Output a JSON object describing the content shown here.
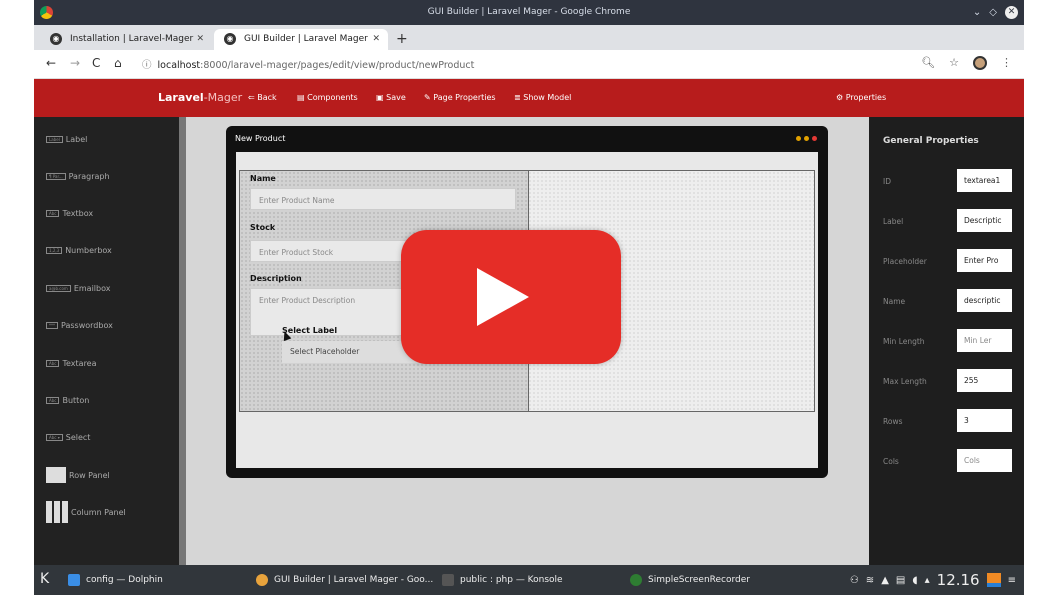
{
  "window_title": "GUI Builder | Laravel Mager - Google Chrome",
  "tabs": [
    {
      "label": "Installation | Laravel-Mager"
    },
    {
      "label": "GUI Builder | Laravel Mager"
    }
  ],
  "address": {
    "host": "localhost",
    "path": ":8000/laravel-mager/pages/edit/view/product/newProduct"
  },
  "app": {
    "brand_bold": "Laravel",
    "brand_rest": "-Mager",
    "nav": {
      "back": "Back",
      "components": "Components",
      "save": "Save",
      "page_properties": "Page Properties",
      "show_model": "Show Model",
      "properties": "Properties"
    }
  },
  "components": [
    {
      "badge": "Label",
      "label": "Label"
    },
    {
      "badge": "¶ Par...",
      "label": "Paragraph"
    },
    {
      "badge": "Abc",
      "label": "Textbox"
    },
    {
      "badge": "1,2,3",
      "label": "Numberbox"
    },
    {
      "badge": "a@b.com",
      "label": "Emailbox"
    },
    {
      "badge": "***",
      "label": "Passwordbox"
    },
    {
      "badge": "Abc",
      "label": "Textarea"
    },
    {
      "badge": "Abc",
      "label": "Button"
    },
    {
      "badge": "Abc ▾",
      "label": "Select"
    },
    {
      "label": "Row Panel"
    },
    {
      "label": "Column Panel"
    }
  ],
  "canvas": {
    "window_title": "New Product",
    "form": {
      "name_label": "Name",
      "name_placeholder": "Enter Product Name",
      "stock_label": "Stock",
      "stock_placeholder": "Enter Product Stock",
      "desc_label": "Description",
      "desc_placeholder": "Enter Product Description",
      "select_label": "Select Label",
      "select_placeholder": "Select Placeholder"
    }
  },
  "properties": {
    "title": "General Properties",
    "rows": [
      {
        "label": "ID",
        "value": "textarea1",
        "placeholder": false
      },
      {
        "label": "Label",
        "value": "Descriptic",
        "placeholder": false
      },
      {
        "label": "Placeholder",
        "value": "Enter Pro",
        "placeholder": false
      },
      {
        "label": "Name",
        "value": "descriptic",
        "placeholder": false
      },
      {
        "label": "Min Length",
        "value": "Min Ler",
        "placeholder": true
      },
      {
        "label": "Max Length",
        "value": "255",
        "placeholder": false
      },
      {
        "label": "Rows",
        "value": "3",
        "placeholder": false
      },
      {
        "label": "Cols",
        "value": "Cols",
        "placeholder": true
      }
    ]
  },
  "taskbar": {
    "items": [
      "config — Dolphin",
      "GUI Builder | Laravel Mager - Goo...",
      "public : php — Konsole",
      "SimpleScreenRecorder"
    ],
    "clock": "12.16"
  },
  "colors": {
    "accent": "#b71c1c",
    "play": "#e52d27"
  }
}
